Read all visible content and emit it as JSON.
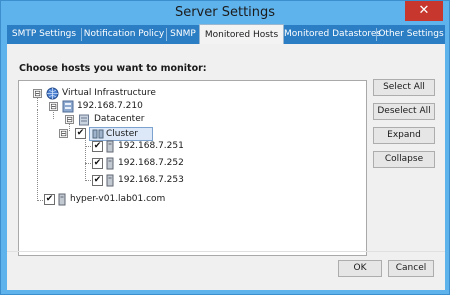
{
  "window": {
    "title": "Server Settings",
    "close_glyph": "✕"
  },
  "tabs": [
    {
      "label": "SMTP Settings",
      "active": false
    },
    {
      "label": "Notification Policy",
      "active": false
    },
    {
      "label": "SNMP",
      "active": false
    },
    {
      "label": "Monitored Hosts",
      "active": true
    },
    {
      "label": "Monitored Datastores",
      "active": false
    },
    {
      "label": "Other Settings",
      "active": false
    }
  ],
  "main": {
    "heading": "Choose hosts you want to monitor:"
  },
  "tree": {
    "root": {
      "label": "Virtual Infrastructure",
      "icon": "globe-icon",
      "expander": "⊟"
    },
    "vcenter": {
      "label": "192.168.7.210",
      "icon": "vcenter-server-icon",
      "expander": "⊟"
    },
    "datacenter": {
      "label": "Datacenter",
      "icon": "datacenter-icon",
      "expander": "⊟"
    },
    "cluster": {
      "label": "Cluster",
      "icon": "cluster-icon",
      "expander": "⊟",
      "checked": true
    },
    "hosts": [
      {
        "label": "192.168.7.251",
        "icon": "host-icon",
        "checked": true
      },
      {
        "label": "192.168.7.252",
        "icon": "host-icon",
        "checked": true
      },
      {
        "label": "192.168.7.253",
        "icon": "host-icon",
        "checked": true
      }
    ],
    "hyperv": {
      "label": "hyper-v01.lab01.com",
      "icon": "host-icon",
      "checked": true
    },
    "check_glyph": "✔"
  },
  "side_buttons": {
    "select_all": "Select All",
    "deselect_all": "Deselect All",
    "expand": "Expand",
    "collapse": "Collapse"
  },
  "footer": {
    "ok": "OK",
    "cancel": "Cancel"
  },
  "colors": {
    "title_bar": "#5fb3ec",
    "tab_strip": "#2c7ec4",
    "close_button": "#c7372e",
    "selection": "#dce8f7"
  }
}
